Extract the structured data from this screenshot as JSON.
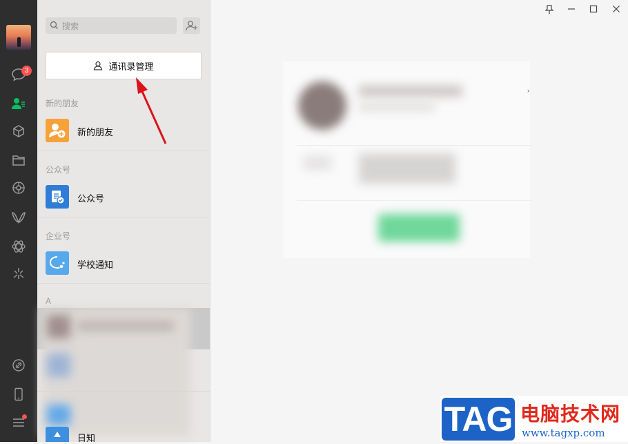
{
  "nav": {
    "badge_count": "3",
    "icons": [
      "chat-icon",
      "contacts-icon",
      "favorites-icon",
      "files-icon",
      "moments-icon",
      "channels-icon",
      "search-icon-nav",
      "mini-programs-icon",
      "link-icon",
      "phone-icon",
      "menu-icon"
    ]
  },
  "search": {
    "placeholder": "搜索"
  },
  "contacts": {
    "manage_label": "通讯录管理",
    "sections": {
      "new_friends": "新的朋友",
      "official": "公众号",
      "work": "企业号",
      "letter_a": "A"
    },
    "items": {
      "new_friends": "新的朋友",
      "official": "公众号",
      "school": "学校通知",
      "partial": "日知"
    }
  },
  "colors": {
    "nav_bg": "#2e2e2e",
    "accent_green": "#07c160",
    "badge_red": "#fa5151",
    "orange_icon": "#f6a13a",
    "blue_icon": "#2f7dd7",
    "light_blue_icon": "#58a8ec"
  },
  "watermark": {
    "logo": "TAG",
    "site_name": "电脑技术网",
    "url": "www.tagxp.com"
  }
}
